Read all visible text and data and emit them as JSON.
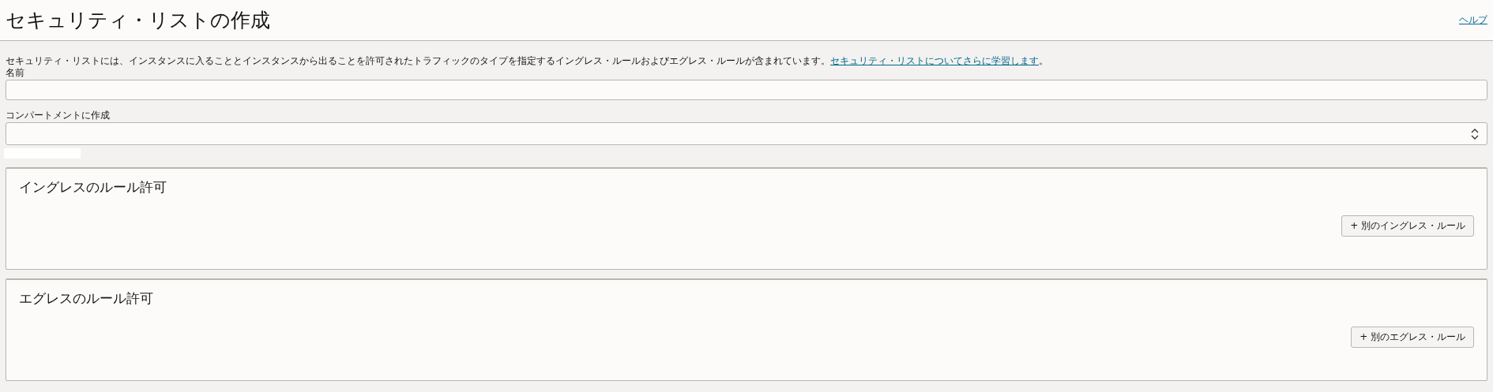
{
  "header": {
    "title": "セキュリティ・リストの作成",
    "help_link": "ヘルプ"
  },
  "description": {
    "text": "セキュリティ・リストには、インスタンスに入ることとインスタンスから出ることを許可されたトラフィックのタイプを指定するイングレス・ルールおよびエグレス・ルールが含まれています。",
    "link": "セキュリティ・リストについてさらに学習します",
    "after": "。"
  },
  "fields": [
    {
      "kind": "text",
      "label": "名前"
    },
    {
      "kind": "select",
      "label": "コンパートメントに作成"
    }
  ],
  "sections": [
    {
      "title": "イングレスのルール許可",
      "button": "+ 別のイングレス・ルール"
    },
    {
      "title": "エグレスのルール許可",
      "button": "+ 別のエグレス・ルール"
    }
  ]
}
